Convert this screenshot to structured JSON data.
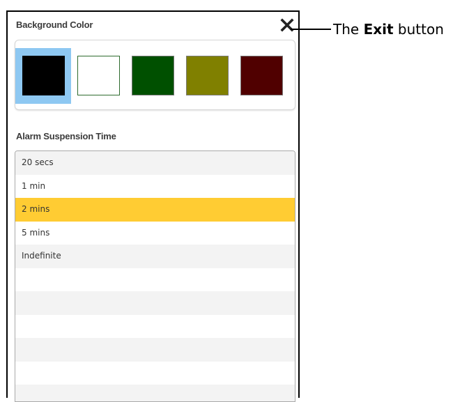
{
  "panel": {
    "background_color_title": "Background Color",
    "exit_icon": "close-x-icon",
    "swatches": [
      {
        "color": "#000000",
        "selected": true
      },
      {
        "color": "#ffffff",
        "selected": false
      },
      {
        "color": "#005000",
        "selected": false
      },
      {
        "color": "#808000",
        "selected": false
      },
      {
        "color": "#500000",
        "selected": false
      }
    ],
    "selection_highlight_color": "#8ec8f2",
    "alarm_title": "Alarm Suspension Time",
    "alarm_options": [
      "20 secs",
      "1 min",
      "2 mins",
      "5 mins",
      "Indefinite"
    ],
    "alarm_selected_index": 2,
    "alarm_selected_color": "#ffcc33"
  },
  "callout": {
    "prefix": "The ",
    "bold": "Exit",
    "suffix": " button"
  }
}
